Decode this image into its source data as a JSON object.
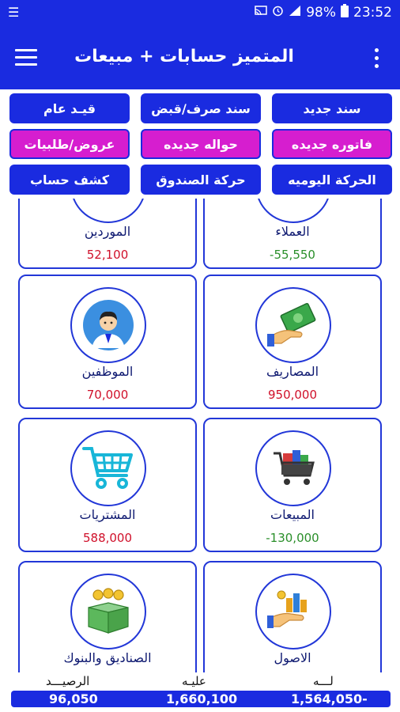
{
  "status_bar": {
    "battery": "98%",
    "time": "23:52"
  },
  "app_bar": {
    "title": "المتميز حسابات + مبيعات"
  },
  "actions": {
    "new_voucher": "سند جديد",
    "payment_receipt": "سند صرف/قبض",
    "general_entry": "قيـد عام",
    "new_invoice": "فاتوره جديده",
    "new_transfer": "حواله جديده",
    "offers_orders": "عروض/طلبيات",
    "daily_movement": "الحركة اليوميه",
    "cashbox_movement": "حركة الصندوق",
    "account_statement": "كشف حساب"
  },
  "cards": {
    "customers": {
      "label": "العملاء",
      "value": "-55,550"
    },
    "suppliers": {
      "label": "الموردين",
      "value": "52,100"
    },
    "expenses": {
      "label": "المصاريف",
      "value": "950,000"
    },
    "employees": {
      "label": "الموظفين",
      "value": "70,000"
    },
    "sales": {
      "label": "المبيعات",
      "value": "-130,000"
    },
    "purchases": {
      "label": "المشتريات",
      "value": "588,000"
    },
    "assets": {
      "label": "الاصول",
      "value": ""
    },
    "cash_banks": {
      "label": "الصناديق والبنوك",
      "value": ""
    }
  },
  "footer": {
    "credit_label": "لـــه",
    "debit_label": "عليـه",
    "balance_label": "الرصيـــد",
    "credit_value": "1,564,050-",
    "debit_value": "1,660,100",
    "balance_value": "96,050"
  },
  "colors": {
    "primary": "#1a2be0",
    "accent": "#d61ecf",
    "negative": "#2a8f2a",
    "positive": "#d0102a"
  }
}
